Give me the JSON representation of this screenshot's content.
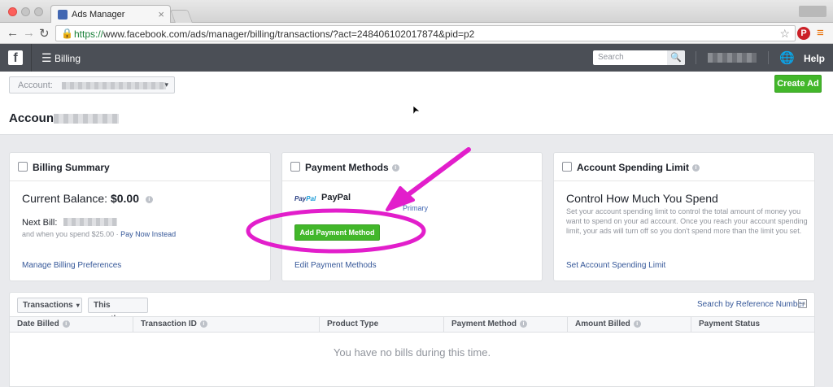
{
  "browser": {
    "tab_title": "Ads Manager",
    "tab_close": "×",
    "url_secure": "https://",
    "url_rest": "www.facebook.com/ads/manager/billing/transactions/?act=248406102017874&pid=p2",
    "back": "←",
    "forward": "→",
    "reload": "↻",
    "lock": "🔒",
    "star": "☆",
    "pin": "P",
    "menu": "≡"
  },
  "fbbar": {
    "logo": "f",
    "hamburger": "☰",
    "section": "Billing",
    "search_placeholder": "Search",
    "search_icon": "🔍",
    "globe": "🌐",
    "help": "Help"
  },
  "account": {
    "select_label": "Account:",
    "select_caret": "▾",
    "create_ad": "Create Ad",
    "title": "Account:",
    "cursor": "➤"
  },
  "billing_summary": {
    "title": "Billing Summary",
    "balance_label": "Current Balance:",
    "balance_value": "$0.00",
    "next_bill": "Next Bill:",
    "when_spend": "and when you spend $25.00 · ",
    "pay_now": "Pay Now Instead",
    "link": "Manage Billing Preferences"
  },
  "payment_methods": {
    "title": "Payment Methods",
    "paypal_logo_a": "Pay",
    "paypal_logo_b": "Pal",
    "paypal_name": "PayPal",
    "primary": "Primary",
    "add_button": "Add Payment Method",
    "link": "Edit Payment Methods"
  },
  "spending_limit": {
    "title": "Account Spending Limit",
    "heading": "Control How Much You Spend",
    "description": "Set your account spending limit to control the total amount of money you want to spend on your ad account. Once you reach your account spending limit, your ads will turn off so you don't spend more than the limit you set.",
    "link": "Set Account Spending Limit"
  },
  "transactions": {
    "filter_type": "Transactions",
    "filter_period": "This month",
    "caret": "▾",
    "search_ref": "Search by Reference Number",
    "search_ref_icon": "⇥",
    "columns": [
      "Date Billed",
      "Transaction ID",
      "Product Type",
      "Payment Method",
      "Amount Billed",
      "Payment Status"
    ],
    "info": "i",
    "empty": "You have no bills during this time."
  },
  "colors": {
    "annotation": "#e21ecb",
    "fb_green": "#42b72a",
    "fb_dark": "#4b4f56",
    "link_blue": "#365899"
  }
}
